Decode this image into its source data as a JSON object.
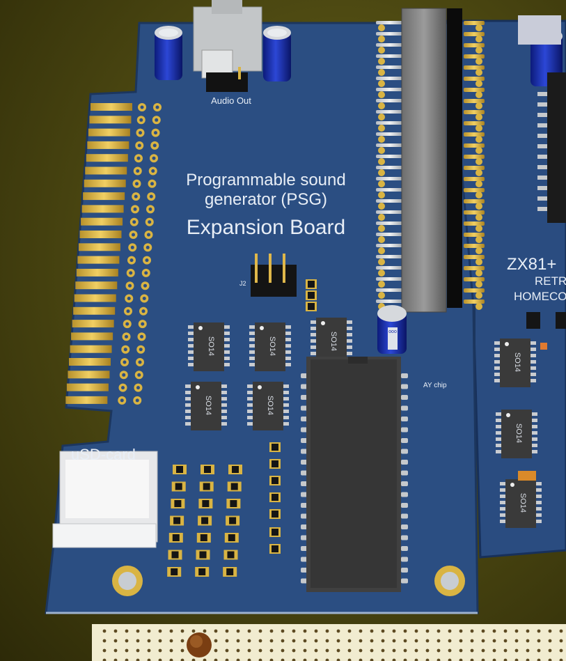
{
  "board": {
    "title_line1": "Programmable sound",
    "title_line2": "generator (PSG)",
    "title_line3": "Expansion Board",
    "audio_label": "Audio Out",
    "jumper_label": "J2",
    "chip_label": "AY chip",
    "sd_label": "uSD-card",
    "ic_marking": "SO14"
  },
  "main_board": {
    "name_line1": "ZX81+",
    "name_line2": "RETR",
    "name_line3": "HOMECO"
  },
  "colors": {
    "pcb": "#2b4e82",
    "pcb_edge": "#1c365e",
    "gold": "#d9b443",
    "ic_body": "#3a3a3a",
    "capacitor": "#1a2fb0",
    "background": "#4e4a12"
  }
}
